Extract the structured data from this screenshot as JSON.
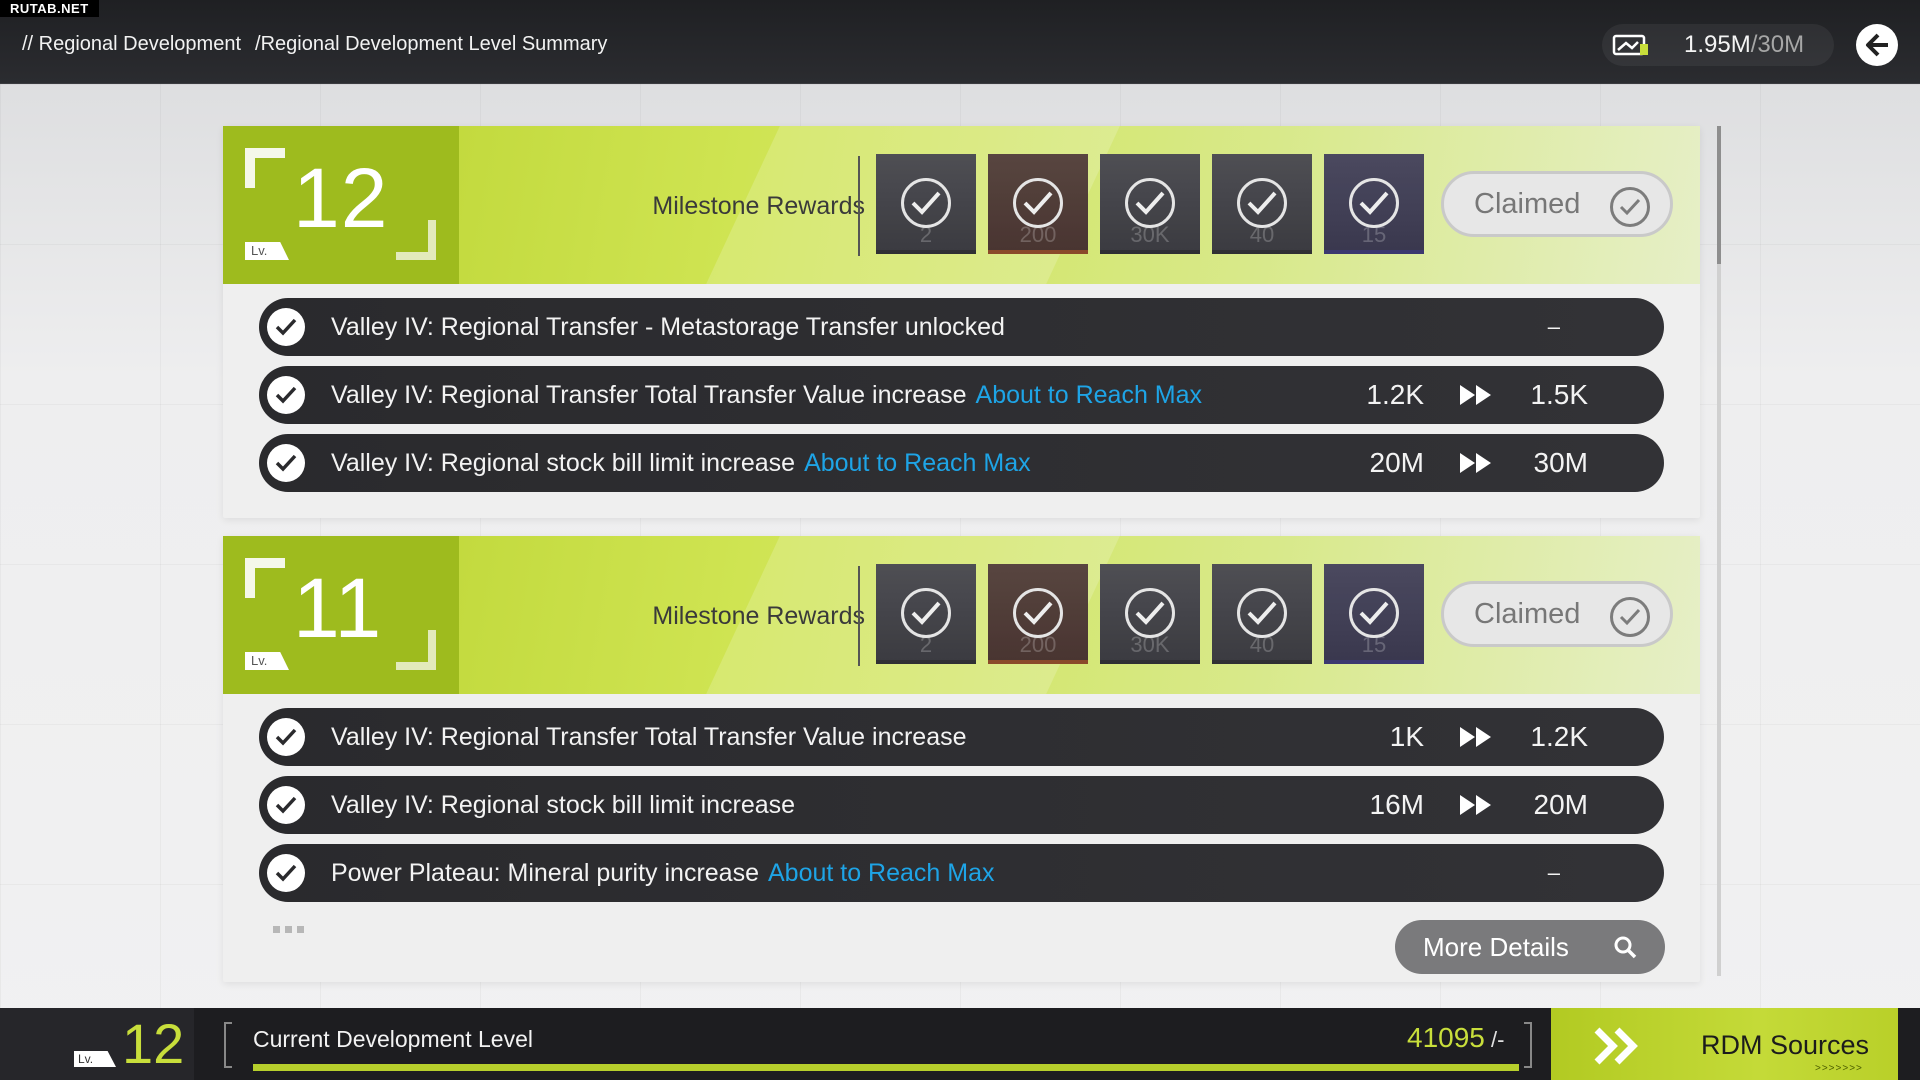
{
  "watermark": "RUTAB.NET",
  "header": {
    "breadcrumb_root": "// Regional Development",
    "breadcrumb_current": "/Regional Development Level Summary",
    "resource_value": "1.95M",
    "resource_max": "/30M",
    "icons": {
      "resource": "stock-bill-icon",
      "back": "back-arrow-icon"
    }
  },
  "levels": [
    {
      "level": "12",
      "level_tag": "Lv.",
      "milestone_label": "Milestone Rewards",
      "rewards": [
        {
          "qty": "2"
        },
        {
          "qty": "200"
        },
        {
          "qty": "30K"
        },
        {
          "qty": "40"
        },
        {
          "qty": "15"
        }
      ],
      "status": "Claimed",
      "rows": [
        {
          "text": "Valley IV: Regional Transfer - Metastorage Transfer unlocked",
          "tag": "",
          "from": "",
          "to": "",
          "dash": "–"
        },
        {
          "text": "Valley IV: Regional Transfer Total Transfer Value increase",
          "tag": "About to Reach Max",
          "from": "1.2K",
          "to": "1.5K",
          "dash": ""
        },
        {
          "text": "Valley IV: Regional stock bill limit increase",
          "tag": "About to Reach Max",
          "from": "20M",
          "to": "30M",
          "dash": ""
        }
      ]
    },
    {
      "level": "11",
      "level_tag": "Lv.",
      "milestone_label": "Milestone Rewards",
      "rewards": [
        {
          "qty": "2"
        },
        {
          "qty": "200"
        },
        {
          "qty": "30K"
        },
        {
          "qty": "40"
        },
        {
          "qty": "15"
        }
      ],
      "status": "Claimed",
      "rows": [
        {
          "text": "Valley IV: Regional Transfer Total Transfer Value increase",
          "tag": "",
          "from": "1K",
          "to": "1.2K",
          "dash": ""
        },
        {
          "text": "Valley IV: Regional stock bill limit increase",
          "tag": "",
          "from": "16M",
          "to": "20M",
          "dash": ""
        },
        {
          "text": "Power Plateau: Mineral purity increase",
          "tag": "About to Reach Max",
          "from": "",
          "to": "",
          "dash": "–"
        }
      ],
      "more_details": "More Details"
    }
  ],
  "footer": {
    "level_tag": "Lv.",
    "level": "12",
    "label": "Current Development Level",
    "value": "41095",
    "value_suffix": " /-",
    "progress": 1.0,
    "rdm_label": "RDM Sources",
    "rdm_small": ">>>>>>>"
  },
  "colors": {
    "accent_lime": "#c8de3b",
    "tag_blue": "#1ea4e6",
    "row_dark": "#2a2a2d"
  }
}
